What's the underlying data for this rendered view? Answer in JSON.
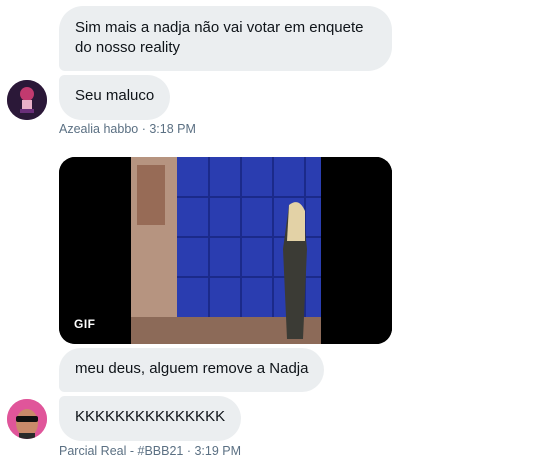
{
  "messages": {
    "m1": "Sim mais a nadja não vai votar em enquete do nosso reality",
    "m2": "Seu maluco",
    "m3": "meu deus, alguem remove a Nadja",
    "m4": "KKKKKKKKKKKKKKK"
  },
  "meta": {
    "first": "Azealia habbo · 3:18 PM",
    "second": "Parcial Real - #BBB21 · 3:19 PM"
  },
  "gif": {
    "badge": "GIF"
  },
  "icons": {
    "avatar1": "user-avatar",
    "avatar2": "user-avatar"
  },
  "colors": {
    "bubble": "#ebeef0",
    "meta": "#5b7083",
    "door": "#2a3db0"
  }
}
